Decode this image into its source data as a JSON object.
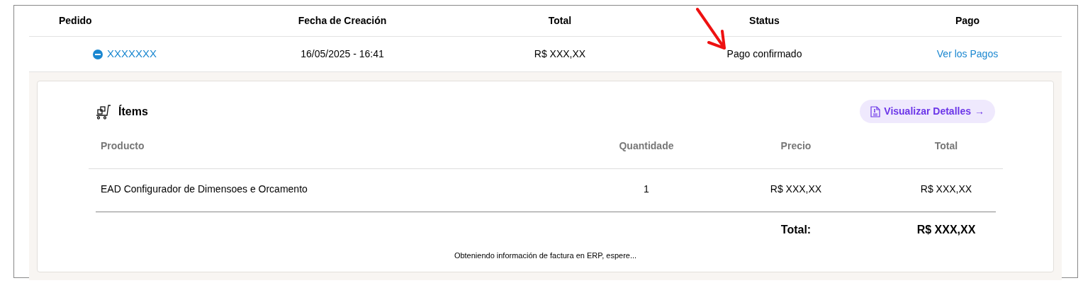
{
  "orders_table": {
    "columns": [
      "Pedido",
      "Fecha de Creación",
      "Total",
      "Status",
      "Pago"
    ],
    "rows": [
      {
        "order": "XXXXXXX",
        "expanded": true,
        "date": "16/05/2025 - 16:41",
        "total": "R$ XXX,XX",
        "status": "Pago confirmado",
        "payments_link": "Ver los Pagos",
        "details": {
          "title": "Ítems",
          "details_button": "Visualizar Detalles",
          "arrow": "→",
          "columns": [
            "Producto",
            "Quantidade",
            "Precio",
            "Total"
          ],
          "items": [
            {
              "product": "EAD Configurador de Dimensoes e Orcamento",
              "quantity": "1",
              "price": "R$ XXX,XX",
              "total": "R$ XXX,XX"
            }
          ],
          "total_label": "Total:",
          "total_value": "R$ XXX,XX",
          "invoice_status": "Obteniendo información de factura en ERP, espere..."
        }
      }
    ]
  }
}
